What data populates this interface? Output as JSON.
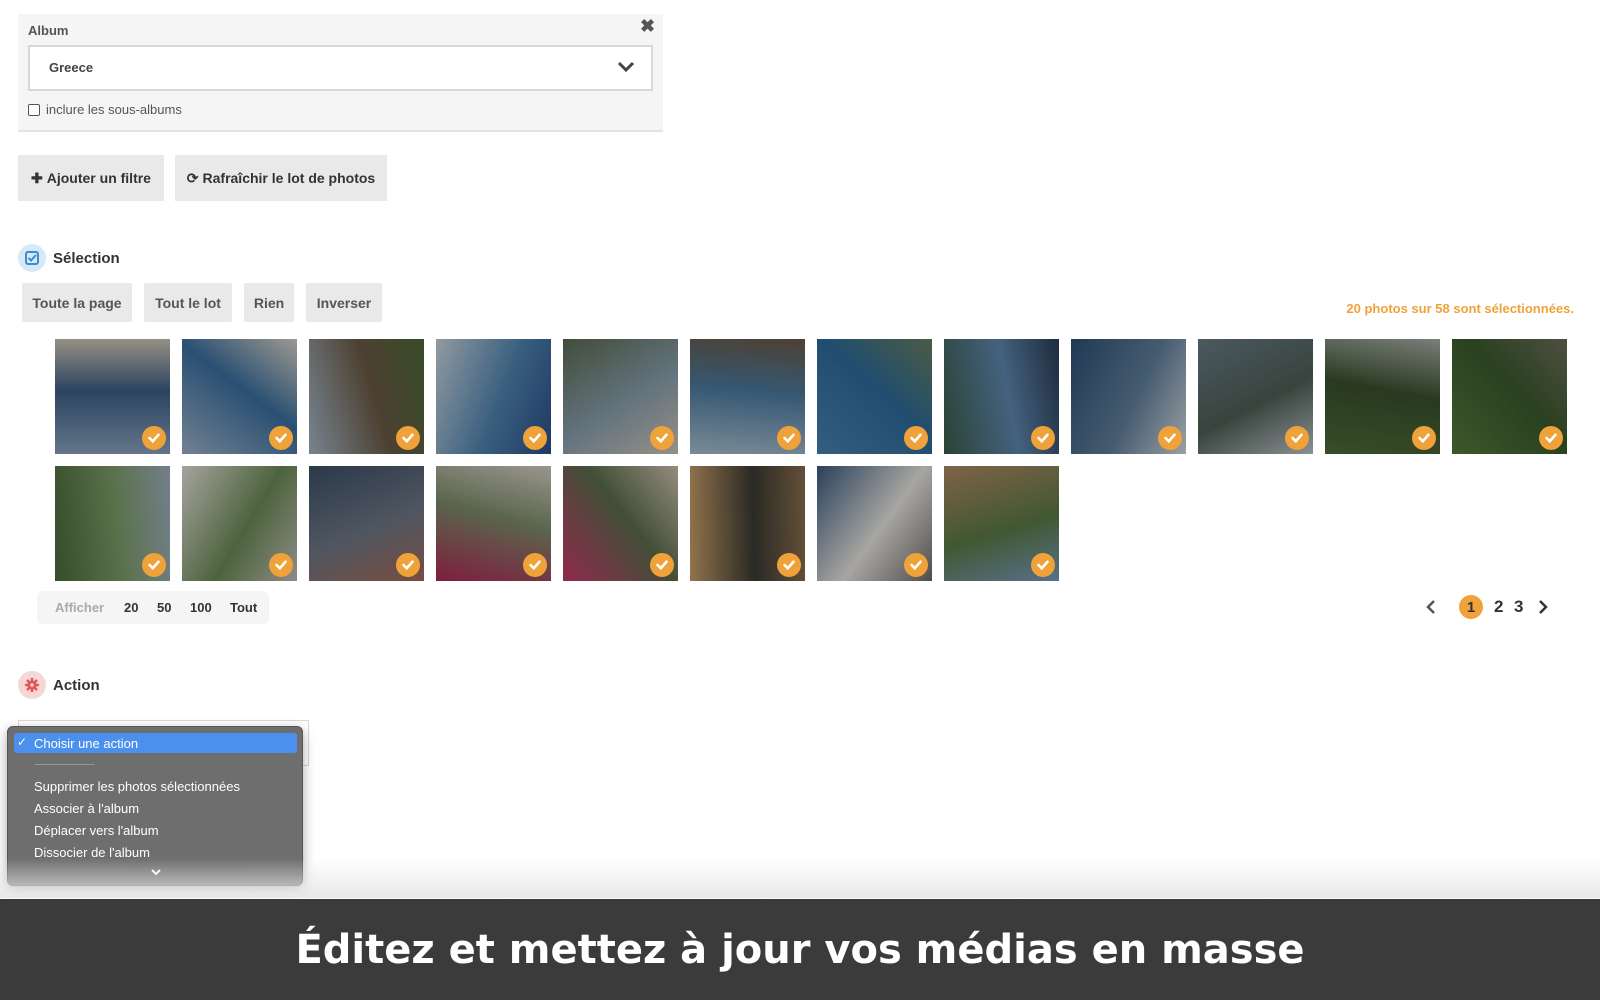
{
  "album_filter": {
    "label": "Album",
    "selected_album": "Greece",
    "include_subalbums_label": "inclure les sous-albums",
    "include_subalbums_checked": false
  },
  "filter_buttons": {
    "add_filter": "Ajouter un filtre",
    "refresh_lot": "Rafraîchir le lot de photos"
  },
  "selection": {
    "title": "Sélection",
    "buttons": {
      "whole_page": "Toute la page",
      "whole_lot": "Tout le lot",
      "none": "Rien",
      "invert": "Inverser"
    },
    "count_text": "20 photos sur 58 sont sélectionnées."
  },
  "photos": [
    {
      "scene": "cliff coast blue sea",
      "selected": true
    },
    {
      "scene": "white house blue door",
      "selected": true
    },
    {
      "scene": "stone house garden",
      "selected": true
    },
    {
      "scene": "blue bench beach",
      "selected": true
    },
    {
      "scene": "boat under tree",
      "selected": true
    },
    {
      "scene": "pebble beach bay",
      "selected": true
    },
    {
      "scene": "island in sea",
      "selected": true
    },
    {
      "scene": "tree over water",
      "selected": true
    },
    {
      "scene": "aerial wing view",
      "selected": true
    },
    {
      "scene": "aerial island",
      "selected": true
    },
    {
      "scene": "potted plants",
      "selected": true
    },
    {
      "scene": "green plant",
      "selected": true
    },
    {
      "scene": "green tree",
      "selected": true
    },
    {
      "scene": "white wall leaves",
      "selected": true
    },
    {
      "scene": "blue shutters",
      "selected": true
    },
    {
      "scene": "pink bougainvillea street",
      "selected": true
    },
    {
      "scene": "pink bougainvillea",
      "selected": true
    },
    {
      "scene": "iron gate",
      "selected": true
    },
    {
      "scene": "white house window",
      "selected": true
    },
    {
      "scene": "stone house palm",
      "selected": true
    }
  ],
  "display": {
    "label": "Afficher",
    "options": [
      "20",
      "50",
      "100",
      "Tout"
    ]
  },
  "pagination": {
    "current": "1",
    "pages": [
      "1",
      "2",
      "3"
    ]
  },
  "action": {
    "title": "Action",
    "menu_items": {
      "choose": "Choisir une action",
      "separator": "------------------",
      "delete": "Supprimer les photos sélectionnées",
      "associate": "Associer à l'album",
      "move": "Déplacer vers l'album",
      "dissociate": "Dissocier de l'album"
    },
    "selected_item": "Choisir une action"
  },
  "banner": {
    "text": "Éditez et mettez à jour vos médias en masse"
  },
  "colors": {
    "accent": "#f0a23a",
    "menu_highlight": "#4c90ee",
    "banner_bg": "#3b3b3b"
  },
  "icons": [
    "close-icon",
    "chevron-down-icon",
    "plus-icon",
    "refresh-icon",
    "checkbox-icon",
    "gear-icon",
    "check-icon",
    "chevron-left-icon",
    "chevron-right-icon"
  ]
}
